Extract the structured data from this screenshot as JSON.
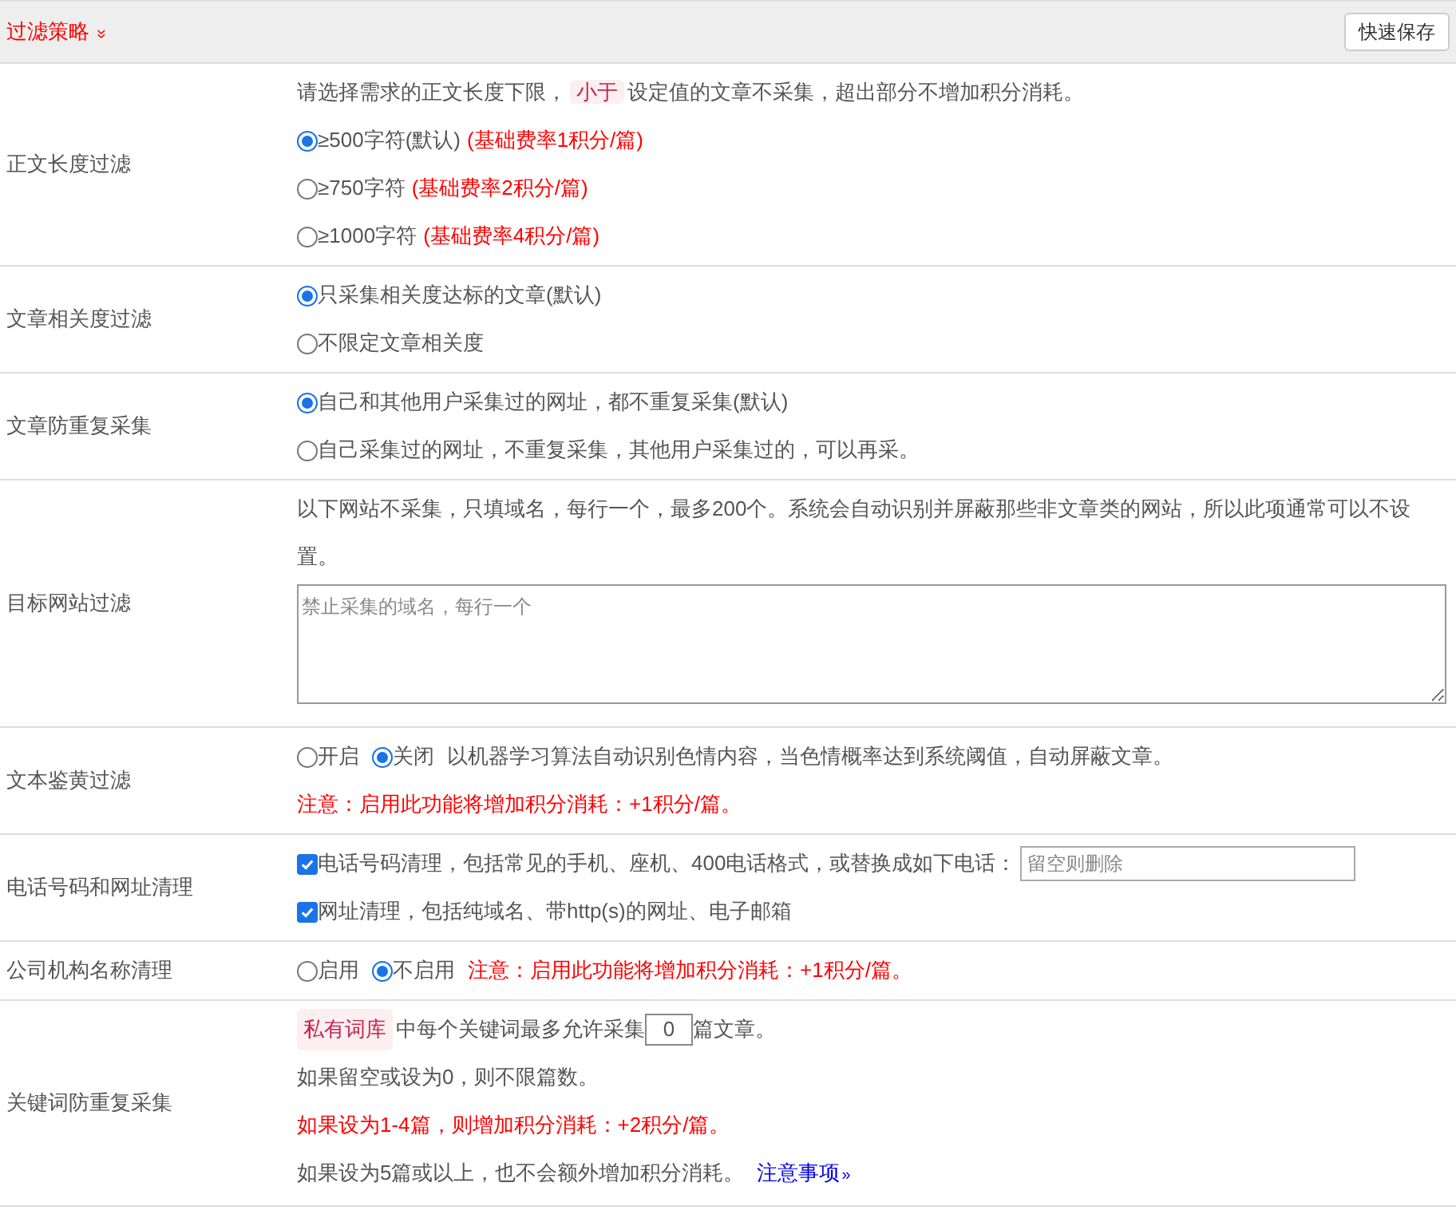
{
  "header": {
    "title": "过滤策略",
    "toggle": "»",
    "save_button": "快速保存"
  },
  "rows": [
    {
      "label": "正文长度过滤",
      "lines": [
        {
          "kind": "text",
          "parts": [
            {
              "text": "请选择需求的正文长度下限，"
            },
            {
              "text": "小于",
              "tag": true
            },
            {
              "text": "设定值的文章不采集，超出部分不增加积分消耗。"
            }
          ]
        },
        {
          "kind": "radio",
          "selected": true,
          "text": "≥500字符(默认)",
          "note": "(基础费率1积分/篇)"
        },
        {
          "kind": "radio",
          "selected": false,
          "text": "≥750字符",
          "note": "(基础费率2积分/篇)"
        },
        {
          "kind": "radio",
          "selected": false,
          "text": "≥1000字符",
          "note": "(基础费率4积分/篇)"
        }
      ]
    },
    {
      "label": "文章相关度过滤",
      "lines": [
        {
          "kind": "radio",
          "selected": true,
          "text": "只采集相关度达标的文章(默认)"
        },
        {
          "kind": "radio",
          "selected": false,
          "text": "不限定文章相关度"
        }
      ]
    },
    {
      "label": "文章防重复采集",
      "lines": [
        {
          "kind": "radio",
          "selected": true,
          "text": "自己和其他用户采集过的网址，都不重复采集(默认)"
        },
        {
          "kind": "radio",
          "selected": false,
          "text": "自己采集过的网址，不重复采集，其他用户采集过的，可以再采。"
        }
      ]
    },
    {
      "label": "目标网站过滤",
      "lines": [
        {
          "kind": "text",
          "parts": [
            {
              "text": "以下网站不采集，只填域名，每行一个，最多200个。系统会自动识别并屏蔽那些非文章类的网站，所以此项通常可以不设置。"
            }
          ]
        },
        {
          "kind": "textarea",
          "placeholder": "禁止采集的域名，每行一个"
        }
      ]
    },
    {
      "label": "文本鉴黄过滤",
      "lines": [
        {
          "kind": "radios",
          "options": [
            {
              "text": "开启",
              "selected": false
            },
            {
              "text": "关闭",
              "selected": true
            }
          ],
          "text": "以机器学习算法自动识别色情内容，当色情概率达到系统阈值，自动屏蔽文章。"
        },
        {
          "kind": "warn",
          "text": "注意：启用此功能将增加积分消耗：+1积分/篇。"
        }
      ]
    },
    {
      "label": "电话号码和网址清理",
      "lines": [
        {
          "kind": "checkbox",
          "checked": true,
          "text": "电话号码清理，包括常见的手机、座机、400电话格式，或替换成如下电话：",
          "placeholder": "留空则删除"
        },
        {
          "kind": "checkbox",
          "checked": true,
          "text": "网址清理，包括纯域名、带http(s)的网址、电子邮箱"
        }
      ]
    },
    {
      "label": "公司机构名称清理",
      "lines": [
        {
          "kind": "radios",
          "options": [
            {
              "text": "启用",
              "selected": false
            },
            {
              "text": "不启用",
              "selected": true
            }
          ],
          "warn": "注意：启用此功能将增加积分消耗：+1积分/篇。"
        }
      ]
    },
    {
      "label": "关键词防重复采集",
      "lines": [
        {
          "kind": "count",
          "tag": "私有词库",
          "before": "中每个关键词最多允许采集",
          "value": "0",
          "after": "篇文章。"
        },
        {
          "kind": "text",
          "parts": [
            {
              "text": "如果留空或设为0，则不限篇数。"
            }
          ]
        },
        {
          "kind": "warn",
          "text": "如果设为1-4篇，则增加积分消耗：+2积分/篇。"
        },
        {
          "kind": "text",
          "parts": [
            {
              "text": "如果设为5篇或以上，也不会额外增加积分消耗。"
            }
          ],
          "link": "注意事项",
          "link_toggle": "»"
        }
      ]
    }
  ]
}
